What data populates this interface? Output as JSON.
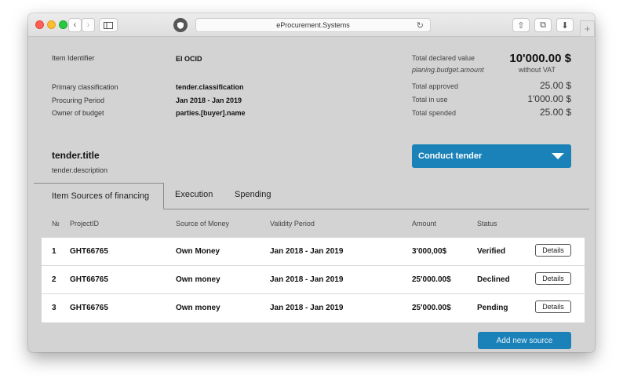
{
  "browser": {
    "url": "eProcurement.Systems",
    "back_glyph": "‹",
    "forward_glyph": "›",
    "reload_glyph": "↻",
    "share_glyph": "⇧",
    "tabs_glyph": "⧉",
    "download_glyph": "⬇",
    "newtab_glyph": "+"
  },
  "info": {
    "item_identifier_label": "Item Identifier",
    "item_identifier_value": "EI OCID",
    "primary_class_label": "Primary classification",
    "primary_class_value": "tender.classification",
    "period_label": "Procuring Period",
    "period_value": "Jan 2018 - Jan 2019",
    "owner_label": "Owner of budget",
    "owner_value": "parties.[buyer].name"
  },
  "totals": {
    "declared_label": "Total declared value",
    "declared_sub": "planing.budget.amount",
    "declared_value": "10'000.00 $",
    "declared_vat": "without VAT",
    "approved_label": "Total approved",
    "approved_value": "25.00 $",
    "inuse_label": "Total in use",
    "inuse_value": "1'000.00 $",
    "spended_label": "Total spended",
    "spended_value": "25.00 $"
  },
  "tender": {
    "title": "tender.title",
    "description": "tender.description",
    "conduct_label": "Conduct tender"
  },
  "tabs": [
    {
      "label": "Item Sources of financing"
    },
    {
      "label": "Execution"
    },
    {
      "label": "Spending"
    }
  ],
  "table": {
    "headers": [
      "№",
      "ProjectID",
      "Source of Money",
      "Validity Period",
      "Amount",
      "Status"
    ],
    "rows": [
      {
        "num": "1",
        "project": "GHT66765",
        "source": "Own Money",
        "period": "Jan 2018 - Jan 2019",
        "amount": "3'000,00$",
        "status": "Verified",
        "action": "Details"
      },
      {
        "num": "2",
        "project": "GHT66765",
        "source": "Own money",
        "period": "Jan 2018 - Jan 2019",
        "amount": "25'000.00$",
        "status": "Declined",
        "action": "Details"
      },
      {
        "num": "3",
        "project": "GHT66765",
        "source": "Own money",
        "period": "Jan 2018 - Jan 2019",
        "amount": "25'000.00$",
        "status": "Pending",
        "action": "Details"
      }
    ]
  },
  "add_source_label": "Add new source",
  "colors": {
    "accent": "#1a82b9",
    "panel": "#d3d3d3"
  }
}
